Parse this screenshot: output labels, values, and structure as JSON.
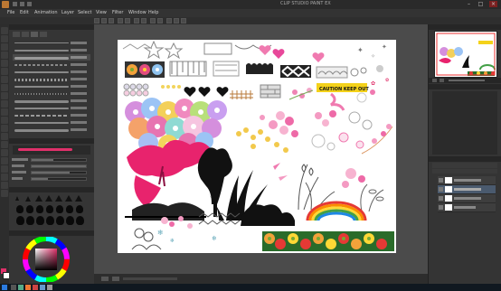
{
  "window": {
    "title": "CLIP STUDIO PAINT EX",
    "minimize_glyph": "–",
    "maximize_glyph": "□",
    "close_glyph": "×"
  },
  "menubar": {
    "items": [
      "File",
      "Edit",
      "Animation",
      "Layer",
      "Select",
      "View",
      "Filter",
      "Window",
      "Help"
    ]
  },
  "canvas_content": {
    "caution_tape_text": "CAUTION KEEP OUT"
  },
  "colors": {
    "accent": "#e0306a",
    "panel": "#353535",
    "canvas_bg": "#ffffff"
  }
}
